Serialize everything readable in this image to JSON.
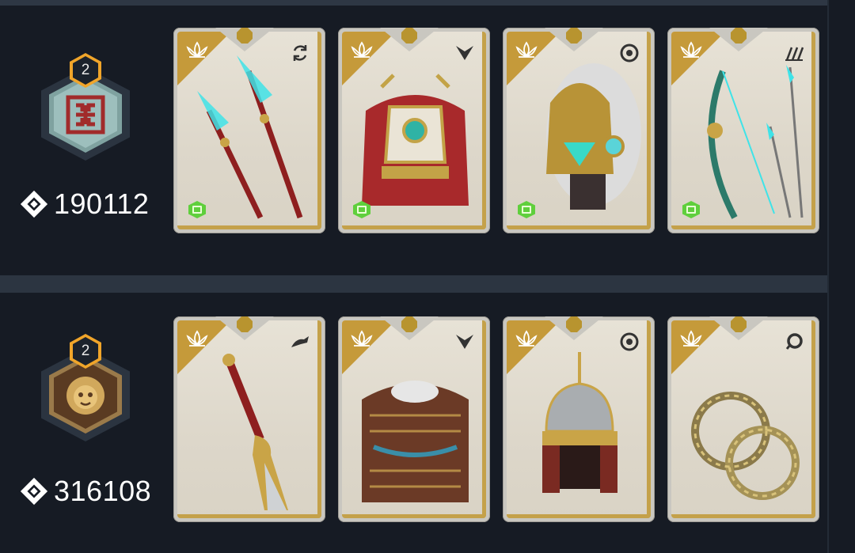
{
  "sets": [
    {
      "rank": "2",
      "emblem": "fret-knot-emblem",
      "score": "190112",
      "items": [
        {
          "name": "twin glaive spears",
          "type_icon": "cycle-icon",
          "has_tag": true
        },
        {
          "name": "ceremonial chest armor",
          "type_icon": "chevron-icon",
          "has_tag": true
        },
        {
          "name": "fur-trimmed golden helm",
          "type_icon": "swirl-icon",
          "has_tag": true
        },
        {
          "name": "jade bow and arrows",
          "type_icon": "arrows-icon",
          "has_tag": true
        }
      ]
    },
    {
      "rank": "2",
      "emblem": "lion-face-emblem",
      "score": "316108",
      "items": [
        {
          "name": "dragon blade",
          "type_icon": "dragon-icon",
          "has_tag": false
        },
        {
          "name": "lamellar chest armor",
          "type_icon": "chevron-icon",
          "has_tag": false
        },
        {
          "name": "steppe helmet",
          "type_icon": "swirl-icon",
          "has_tag": false
        },
        {
          "name": "dragon chakram rings",
          "type_icon": "ring-icon",
          "has_tag": false
        }
      ]
    }
  ],
  "colors": {
    "background": "#161b24",
    "badge_gold": "#f0a52a",
    "card_gold": "#c59a3a",
    "tag_green": "#5fcf3c"
  }
}
